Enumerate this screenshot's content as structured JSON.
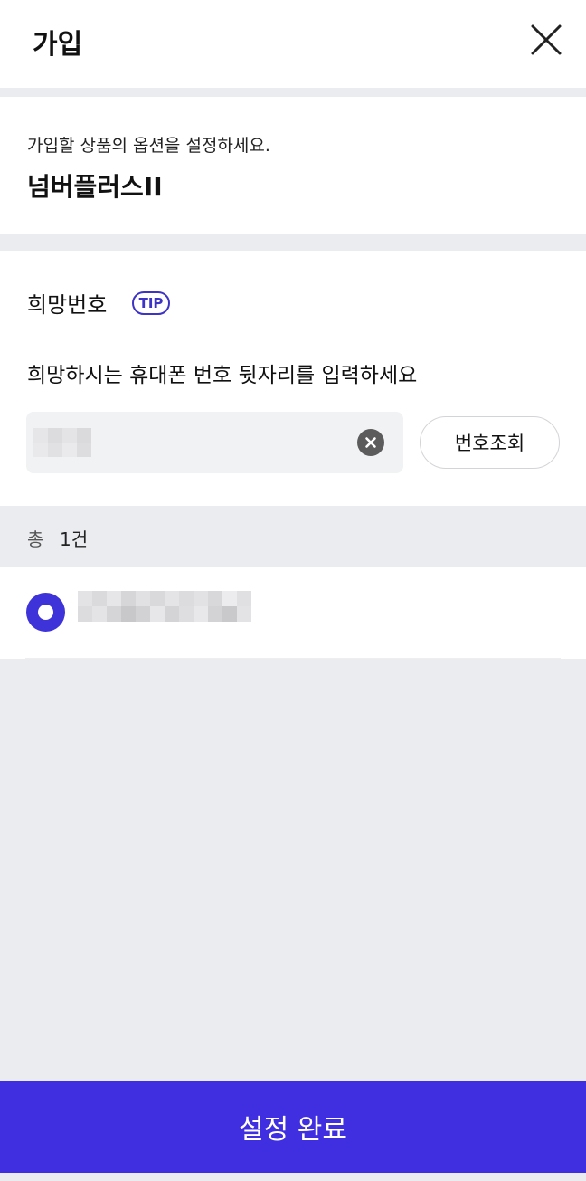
{
  "header": {
    "title": "가입",
    "close_icon": "close-icon"
  },
  "product": {
    "description": "가입할 상품의 옵션을 설정하세요.",
    "name": "넘버플러스II"
  },
  "number_section": {
    "title": "희망번호",
    "tip_label": "TIP",
    "instruction": "희망하시는 휴대폰 번호 뒷자리를 입력하세요",
    "input_value": "",
    "clear_icon": "clear-circle-icon",
    "lookup_button": "번호조회"
  },
  "results": {
    "count_label": "총",
    "count_value": "1건",
    "items": [
      {
        "selected": true,
        "value_redacted": true
      }
    ]
  },
  "footer": {
    "submit_label": "설정 완료"
  },
  "colors": {
    "accent": "#3f2fe0",
    "radio": "#3d33d9",
    "background": "#ebecef"
  }
}
